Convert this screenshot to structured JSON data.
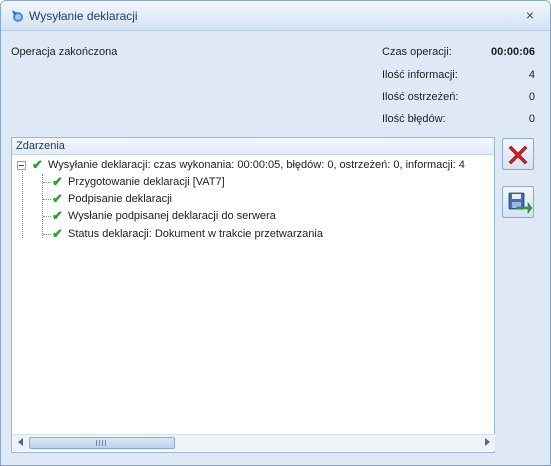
{
  "window": {
    "title": "Wysyłanie deklaracji",
    "close_glyph": "×"
  },
  "summary": {
    "status": "Operacja zakończona",
    "stats": [
      {
        "label": "Czas operacji:",
        "value": "00:00:06"
      },
      {
        "label": "Ilość informacji:",
        "value": "4"
      },
      {
        "label": "Ilość ostrzeżeń:",
        "value": "0"
      },
      {
        "label": "Ilość błędów:",
        "value": "0"
      }
    ]
  },
  "events": {
    "header": "Zdarzenia",
    "root": "Wysyłanie deklaracji: czas wykonania: 00:00:05, błędów: 0, ostrzeżeń: 0, informacji: 4",
    "children": [
      "Przygotowanie deklaracji [VAT7]",
      "Podpisanie deklaracji",
      "Wysłanie podpisanej deklaracji do serwera",
      "Status deklaracji: Dokument w trakcie przetwarzania"
    ]
  },
  "buttons": {
    "cancel_icon": "red-x-icon",
    "save_icon": "floppy-save-icon"
  },
  "colors": {
    "check": "#2aa12a",
    "cancel": "#d21f1f",
    "accent": "#1f3e67"
  }
}
